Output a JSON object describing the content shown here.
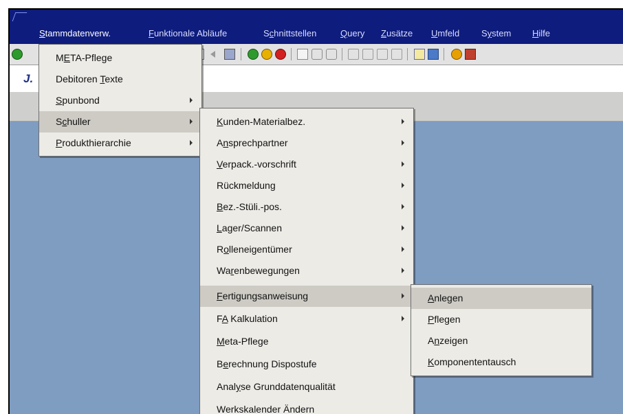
{
  "menubar": {
    "items": [
      {
        "pre": "",
        "u": "S",
        "post": "tammdatenverw.",
        "active": true
      },
      {
        "pre": "",
        "u": "F",
        "post": "unktionale Abläufe",
        "active": false
      },
      {
        "pre": "S",
        "u": "c",
        "post": "hnittstellen",
        "active": false
      },
      {
        "pre": "",
        "u": "Q",
        "post": "uery",
        "active": false
      },
      {
        "pre": "",
        "u": "Z",
        "post": "usätze",
        "active": false
      },
      {
        "pre": "",
        "u": "U",
        "post": "mfeld",
        "active": false
      },
      {
        "pre": "S",
        "u": "y",
        "post": "stem",
        "active": false
      },
      {
        "pre": "",
        "u": "H",
        "post": "ilfe",
        "active": false
      }
    ]
  },
  "toolbar": {
    "icons": [
      "enter-icon",
      "back-icon",
      "save-icon",
      "green-back-icon",
      "exit-icon",
      "cancel-icon",
      "print-icon",
      "find-icon",
      "find-next-icon",
      "first-page-icon",
      "prev-page-icon",
      "next-page-icon",
      "last-page-icon",
      "new-session-icon",
      "shortcut-icon",
      "help-icon",
      "layout-icon"
    ]
  },
  "title": {
    "text": "J."
  },
  "menu1": {
    "items": [
      {
        "pre": "M",
        "u": "E",
        "post": "TA-Pflege",
        "submenu": false,
        "highlighted": false
      },
      {
        "pre": "Debitoren ",
        "u": "T",
        "post": "exte",
        "submenu": false,
        "highlighted": false
      },
      {
        "pre": "",
        "u": "S",
        "post": "punbond",
        "submenu": true,
        "highlighted": false
      },
      {
        "pre": "S",
        "u": "c",
        "post": "huller",
        "submenu": true,
        "highlighted": true
      },
      {
        "pre": "",
        "u": "P",
        "post": "rodukthierarchie",
        "submenu": true,
        "highlighted": false
      }
    ]
  },
  "menu2": {
    "items": [
      {
        "pre": "",
        "u": "K",
        "post": "unden-Materialbez.",
        "submenu": true,
        "highlighted": false
      },
      {
        "pre": "A",
        "u": "n",
        "post": "sprechpartner",
        "submenu": true,
        "highlighted": false
      },
      {
        "pre": "",
        "u": "V",
        "post": "erpack.-vorschrift",
        "submenu": true,
        "highlighted": false
      },
      {
        "pre": "Rückmeldung",
        "u": "",
        "post": "",
        "submenu": true,
        "highlighted": false
      },
      {
        "pre": "",
        "u": "B",
        "post": "ez.-Stüli.-pos.",
        "submenu": true,
        "highlighted": false
      },
      {
        "pre": "",
        "u": "L",
        "post": "ager/Scannen",
        "submenu": true,
        "highlighted": false
      },
      {
        "pre": "R",
        "u": "o",
        "post": "lleneigentümer",
        "submenu": true,
        "highlighted": false
      },
      {
        "pre": "Wa",
        "u": "r",
        "post": "enbewegungen",
        "submenu": true,
        "highlighted": false
      },
      {
        "pre": "",
        "u": "F",
        "post": "ertigungsanweisung",
        "submenu": true,
        "highlighted": true
      },
      {
        "pre": "F",
        "u": "A",
        "post": " Kalkulation",
        "submenu": true,
        "highlighted": false
      },
      {
        "pre": "",
        "u": "M",
        "post": "eta-Pflege",
        "submenu": false,
        "highlighted": false
      },
      {
        "pre": "B",
        "u": "e",
        "post": "rechnung Dispostufe",
        "submenu": false,
        "highlighted": false
      },
      {
        "pre": "Anal",
        "u": "y",
        "post": "se Grunddatenqualität",
        "submenu": false,
        "highlighted": false
      },
      {
        "pre": "Werkskalender Ändern",
        "u": "",
        "post": "",
        "submenu": false,
        "highlighted": false
      }
    ]
  },
  "menu3": {
    "items": [
      {
        "pre": "",
        "u": "A",
        "post": "nlegen",
        "submenu": false,
        "highlighted": true
      },
      {
        "pre": "",
        "u": "P",
        "post": "flegen",
        "submenu": false,
        "highlighted": false
      },
      {
        "pre": "A",
        "u": "n",
        "post": "zeigen",
        "submenu": false,
        "highlighted": false
      },
      {
        "pre": "",
        "u": "K",
        "post": "omponententausch",
        "submenu": false,
        "highlighted": false
      }
    ]
  }
}
